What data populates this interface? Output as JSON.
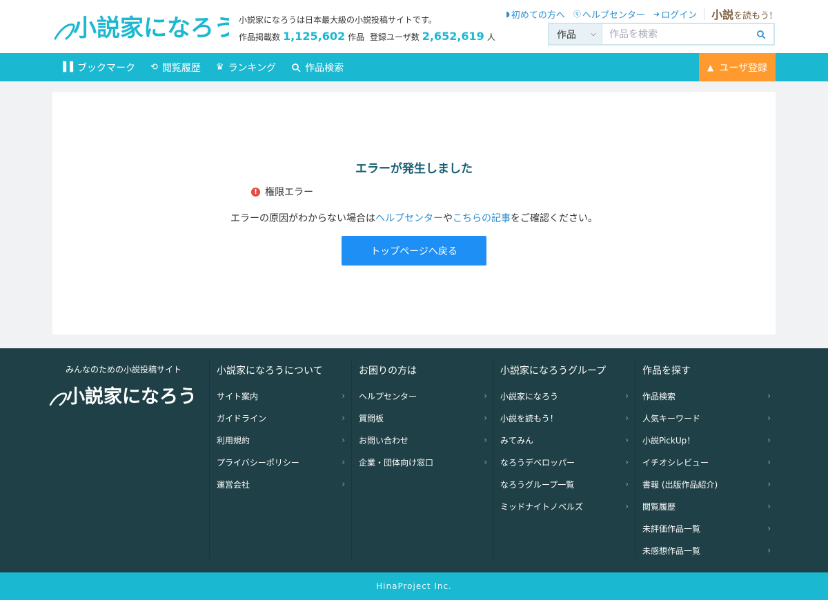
{
  "header": {
    "logo_text": "小説家になろう",
    "tagline": "小説家になろうは日本最大級の小説投稿サイトです。",
    "works_label": "作品掲載数",
    "works_count": "1,125,602",
    "works_unit": "作品",
    "users_label": "登録ユーザ数",
    "users_count": "2,652,619",
    "users_unit": "人",
    "links": {
      "beginners": "初めての方へ",
      "help": "ヘルプセンター",
      "login": "ログイン",
      "yomou_a": "小説",
      "yomou_b": "を読もう!"
    },
    "search": {
      "type_selected": "作品",
      "placeholder": "作品を検索"
    }
  },
  "nav": {
    "bookmark": "ブックマーク",
    "history": "閲覧履歴",
    "ranking": "ランキング",
    "search": "作品検索",
    "register": "ユーザ登録"
  },
  "error": {
    "title": "エラーが発生しました",
    "message": "権限エラー",
    "desc_prefix": "エラーの原因がわからない場合は",
    "help_link": "ヘルプセンター",
    "desc_mid": "や",
    "article_link": "こちらの記事",
    "desc_suffix": "をご確認ください。",
    "back_button": "トップページへ戻る"
  },
  "footer": {
    "catchphrase": "みんなのための小説投稿サイト",
    "logo_text": "小説家になろう",
    "columns": [
      {
        "title": "小説家になろうについて",
        "links": [
          "サイト案内",
          "ガイドライン",
          "利用規約",
          "プライバシーポリシー",
          "運営会社"
        ]
      },
      {
        "title": "お困りの方は",
        "links": [
          "ヘルプセンター",
          "質問板",
          "お問い合わせ",
          "企業・団体向け窓口"
        ]
      },
      {
        "title": "小説家になろうグループ",
        "links": [
          "小説家になろう",
          "小説を読もう！",
          "みてみん",
          "なろうデベロッパー",
          "なろうグループ一覧",
          "ミッドナイトノベルズ"
        ]
      },
      {
        "title": "作品を探す",
        "links": [
          "作品検索",
          "人気キーワード",
          "小説PickUp！",
          "イチオシレビュー",
          "書報 (出版作品紹介)",
          "閲覧履歴",
          "未評価作品一覧",
          "未感想作品一覧"
        ]
      }
    ],
    "copyright": "HinaProject Inc."
  },
  "colors": {
    "nav": "#1ab8d1",
    "register": "#ff9a2e",
    "footer": "#1f4046",
    "button": "#1e8ff5",
    "link": "#2c8ecf"
  },
  "icons": {
    "bookmark": "bookmark-icon",
    "history": "history-icon",
    "ranking": "crown-icon",
    "search": "search-icon",
    "user": "user-icon",
    "error": "error-icon"
  }
}
